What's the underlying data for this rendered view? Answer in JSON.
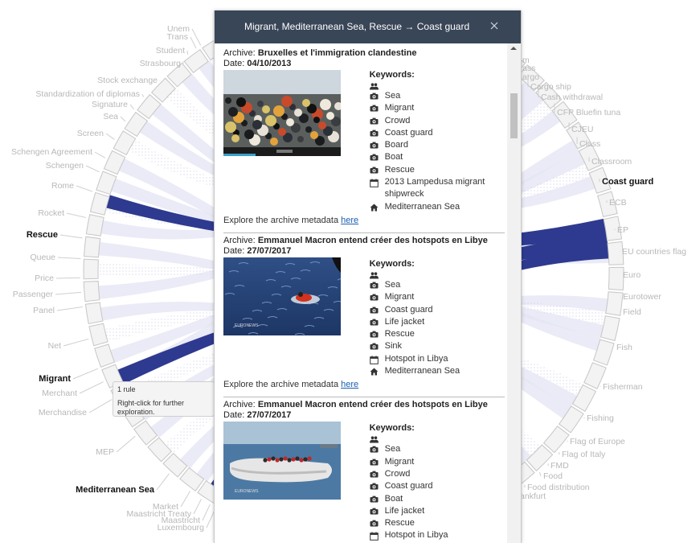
{
  "panel": {
    "title": "Migrant, Mediterranean Sea, Rescue → Coast guard",
    "close_label": "×",
    "entries": [
      {
        "archive_label": "Archive:",
        "archive_title": "Bruxelles et l'immigration clandestine",
        "date_label": "Date:",
        "date": "04/10/2013",
        "keywords_title": "Keywords:",
        "keywords": [
          {
            "icon": "people-icon",
            "text": ""
          },
          {
            "icon": "camera-icon",
            "text": "Sea"
          },
          {
            "icon": "camera-icon",
            "text": "Migrant"
          },
          {
            "icon": "camera-icon",
            "text": "Crowd"
          },
          {
            "icon": "camera-icon",
            "text": "Coast guard"
          },
          {
            "icon": "camera-icon",
            "text": "Board"
          },
          {
            "icon": "camera-icon",
            "text": "Boat"
          },
          {
            "icon": "camera-icon",
            "text": "Rescue"
          },
          {
            "icon": "calendar-icon",
            "text": "2013 Lampedusa migrant shipwreck"
          },
          {
            "icon": "home-icon",
            "text": "Mediterranean Sea"
          }
        ],
        "explore_text": "Explore the archive metadata ",
        "explore_link": "here"
      },
      {
        "archive_label": "Archive:",
        "archive_title": "Emmanuel Macron entend créer des hotspots en Libye",
        "date_label": "Date:",
        "date": "27/07/2017",
        "keywords_title": "Keywords:",
        "keywords": [
          {
            "icon": "people-icon",
            "text": ""
          },
          {
            "icon": "camera-icon",
            "text": "Sea"
          },
          {
            "icon": "camera-icon",
            "text": "Migrant"
          },
          {
            "icon": "camera-icon",
            "text": "Coast guard"
          },
          {
            "icon": "camera-icon",
            "text": "Life jacket"
          },
          {
            "icon": "camera-icon",
            "text": "Rescue"
          },
          {
            "icon": "camera-icon",
            "text": "Sink"
          },
          {
            "icon": "calendar-icon",
            "text": "Hotspot in Libya"
          },
          {
            "icon": "home-icon",
            "text": "Mediterranean Sea"
          }
        ],
        "explore_text": "Explore the archive metadata ",
        "explore_link": "here"
      },
      {
        "archive_label": "Archive:",
        "archive_title": "Emmanuel Macron entend créer des hotspots en Libye",
        "date_label": "Date:",
        "date": "27/07/2017",
        "keywords_title": "Keywords:",
        "keywords": [
          {
            "icon": "people-icon",
            "text": ""
          },
          {
            "icon": "camera-icon",
            "text": "Sea"
          },
          {
            "icon": "camera-icon",
            "text": "Migrant"
          },
          {
            "icon": "camera-icon",
            "text": "Crowd"
          },
          {
            "icon": "camera-icon",
            "text": "Coast guard"
          },
          {
            "icon": "camera-icon",
            "text": "Boat"
          },
          {
            "icon": "camera-icon",
            "text": "Life jacket"
          },
          {
            "icon": "camera-icon",
            "text": "Rescue"
          },
          {
            "icon": "calendar-icon",
            "text": "Hotspot in Libya"
          }
        ],
        "explore_text": "",
        "explore_link": ""
      }
    ]
  },
  "tooltip": {
    "line1": "1 rule",
    "line2": "Right-click for further exploration."
  },
  "chord_labels": {
    "left": [
      "Unem",
      "Trans",
      "Student",
      "Strasbourg",
      "Stock exchange",
      "Standardization of diplomas",
      "Signature",
      "Sea",
      "Screen",
      "Schengen Agreement",
      "Schengen",
      "Rome",
      "Rocket",
      "Rescue",
      "Queue",
      "Price",
      "Passenger",
      "Panel",
      "Net",
      "Migrant",
      "Merchant",
      "Merchandise",
      "MEP",
      "Mediterranean Sea",
      "Market",
      "Maastricht Treaty",
      "Maastricht",
      "Luxembourg"
    ],
    "right": [
      "m",
      "ass",
      "argo",
      "Cargo ship",
      "Cash withdrawal",
      "CFP Bluefin tuna",
      "CJEU",
      "Class",
      "Classroom",
      "Coast guard",
      "ECB",
      "EP",
      "EU countries flag",
      "Euro",
      "Eurotower",
      "Field",
      "Fish",
      "Fisherman",
      "Fishing",
      "Flag of Europe",
      "Flag of Italy",
      "FMD",
      "Food",
      "Food distribution",
      "ankfurt"
    ],
    "highlighted": [
      "Rescue",
      "Migrant",
      "Mediterranean Sea",
      "Coast guard"
    ]
  },
  "colors": {
    "header_bg": "#384657",
    "highlight": "#2e3a8f",
    "chord_light": "#e3e4f3",
    "link": "#1a5fb4"
  }
}
